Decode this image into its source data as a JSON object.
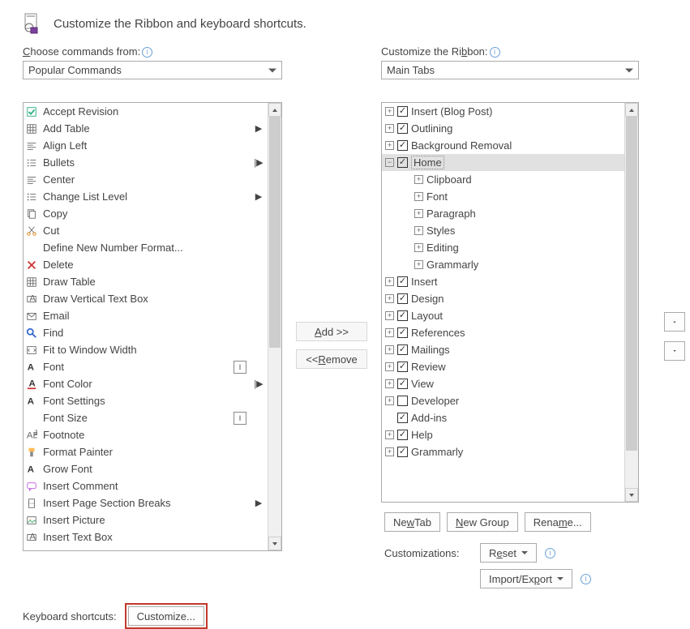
{
  "header": {
    "title": "Customize the Ribbon and keyboard shortcuts."
  },
  "labels": {
    "choose_from_pre": "C",
    "choose_from_post": "hoose commands from:",
    "customize_ribbon_pre": "Customize the Ri",
    "customize_ribbon_u": "b",
    "customize_ribbon_post": "bon:"
  },
  "dropdowns": {
    "left": "Popular Commands",
    "right": "Main Tabs"
  },
  "commands": [
    {
      "label": "Accept Revision",
      "sub": ""
    },
    {
      "label": "Add Table",
      "sub": "▶"
    },
    {
      "label": "Align Left",
      "sub": ""
    },
    {
      "label": "Bullets",
      "sub": "|▶"
    },
    {
      "label": "Center",
      "sub": ""
    },
    {
      "label": "Change List Level",
      "sub": "▶"
    },
    {
      "label": "Copy",
      "sub": ""
    },
    {
      "label": "Cut",
      "sub": ""
    },
    {
      "label": "Define New Number Format...",
      "sub": ""
    },
    {
      "label": "Delete",
      "sub": ""
    },
    {
      "label": "Draw Table",
      "sub": ""
    },
    {
      "label": "Draw Vertical Text Box",
      "sub": ""
    },
    {
      "label": "Email",
      "sub": ""
    },
    {
      "label": "Find",
      "sub": ""
    },
    {
      "label": "Fit to Window Width",
      "sub": ""
    },
    {
      "label": "Font",
      "sub": "",
      "badge": "I"
    },
    {
      "label": "Font Color",
      "sub": "|▶"
    },
    {
      "label": "Font Settings",
      "sub": ""
    },
    {
      "label": "Font Size",
      "sub": "",
      "badge": "I"
    },
    {
      "label": "Footnote",
      "sub": ""
    },
    {
      "label": "Format Painter",
      "sub": ""
    },
    {
      "label": "Grow Font",
      "sub": ""
    },
    {
      "label": "Insert Comment",
      "sub": ""
    },
    {
      "label": "Insert Page  Section Breaks",
      "sub": "▶"
    },
    {
      "label": "Insert Picture",
      "sub": ""
    },
    {
      "label": "Insert Text Box",
      "sub": ""
    }
  ],
  "tree": [
    {
      "exp": "+",
      "chk": true,
      "label": "Insert (Blog Post)",
      "ind": 1
    },
    {
      "exp": "+",
      "chk": true,
      "label": "Outlining",
      "ind": 1
    },
    {
      "exp": "+",
      "chk": true,
      "label": "Background Removal",
      "ind": 1
    },
    {
      "exp": "−",
      "chk": true,
      "label": "Home",
      "ind": 1,
      "selected": true
    },
    {
      "exp": "+",
      "label": "Clipboard",
      "ind": 2
    },
    {
      "exp": "+",
      "label": "Font",
      "ind": 2
    },
    {
      "exp": "+",
      "label": "Paragraph",
      "ind": 2
    },
    {
      "exp": "+",
      "label": "Styles",
      "ind": 2
    },
    {
      "exp": "+",
      "label": "Editing",
      "ind": 2
    },
    {
      "exp": "+",
      "label": "Grammarly",
      "ind": 2
    },
    {
      "exp": "+",
      "chk": true,
      "label": "Insert",
      "ind": 1
    },
    {
      "exp": "+",
      "chk": true,
      "label": "Design",
      "ind": 1
    },
    {
      "exp": "+",
      "chk": true,
      "label": "Layout",
      "ind": 1
    },
    {
      "exp": "+",
      "chk": true,
      "label": "References",
      "ind": 1
    },
    {
      "exp": "+",
      "chk": true,
      "label": "Mailings",
      "ind": 1
    },
    {
      "exp": "+",
      "chk": true,
      "label": "Review",
      "ind": 1
    },
    {
      "exp": "+",
      "chk": true,
      "label": "View",
      "ind": 1
    },
    {
      "exp": "+",
      "chk": false,
      "label": "Developer",
      "ind": 1
    },
    {
      "exp": "",
      "chk": true,
      "label": "Add-ins",
      "ind": 1,
      "noexp": true
    },
    {
      "exp": "+",
      "chk": true,
      "label": "Help",
      "ind": 1
    },
    {
      "exp": "+",
      "chk": true,
      "label": "Grammarly",
      "ind": 1
    }
  ],
  "buttons": {
    "add_pre": "A",
    "add_u": "d",
    "add_post": "d >>",
    "remove": "<< ",
    "remove_u": "R",
    "remove_post": "emove",
    "newtab_pre": "Ne",
    "newtab_u": "w",
    "newtab_post": " Tab",
    "newgroup_u": "N",
    "newgroup_post": "ew Group",
    "rename_pre": "Rena",
    "rename_u": "m",
    "rename_post": "e...",
    "reset_pre": "R",
    "reset_u": "e",
    "reset_post": "set",
    "import_pre": "Import/Ex",
    "import_u": "p",
    "import_post": "ort",
    "customize": "Customize..."
  },
  "texts": {
    "customizations": "Customizations:",
    "kbshort": "Keyboard shortcuts:"
  }
}
